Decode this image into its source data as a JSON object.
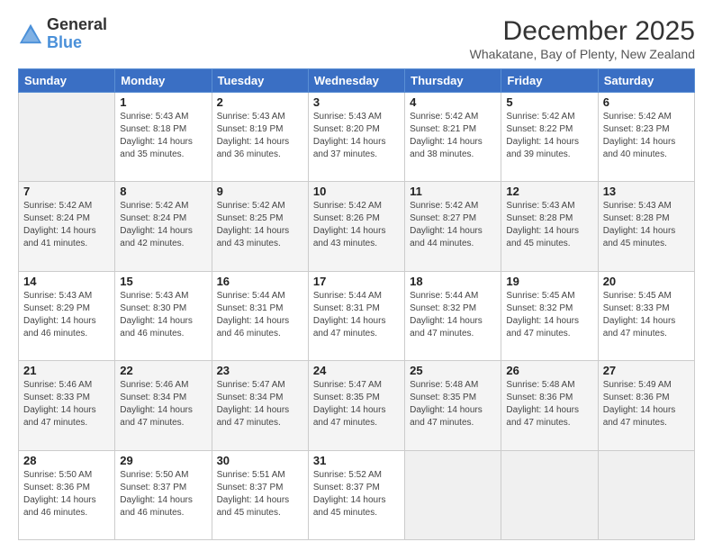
{
  "brand": {
    "name_general": "General",
    "name_blue": "Blue"
  },
  "header": {
    "month_year": "December 2025",
    "location": "Whakatane, Bay of Plenty, New Zealand"
  },
  "days_of_week": [
    "Sunday",
    "Monday",
    "Tuesday",
    "Wednesday",
    "Thursday",
    "Friday",
    "Saturday"
  ],
  "weeks": [
    [
      {
        "day": "",
        "sunrise": "",
        "sunset": "",
        "daylight": "",
        "empty": true
      },
      {
        "day": "1",
        "sunrise": "Sunrise: 5:43 AM",
        "sunset": "Sunset: 8:18 PM",
        "daylight": "Daylight: 14 hours and 35 minutes."
      },
      {
        "day": "2",
        "sunrise": "Sunrise: 5:43 AM",
        "sunset": "Sunset: 8:19 PM",
        "daylight": "Daylight: 14 hours and 36 minutes."
      },
      {
        "day": "3",
        "sunrise": "Sunrise: 5:43 AM",
        "sunset": "Sunset: 8:20 PM",
        "daylight": "Daylight: 14 hours and 37 minutes."
      },
      {
        "day": "4",
        "sunrise": "Sunrise: 5:42 AM",
        "sunset": "Sunset: 8:21 PM",
        "daylight": "Daylight: 14 hours and 38 minutes."
      },
      {
        "day": "5",
        "sunrise": "Sunrise: 5:42 AM",
        "sunset": "Sunset: 8:22 PM",
        "daylight": "Daylight: 14 hours and 39 minutes."
      },
      {
        "day": "6",
        "sunrise": "Sunrise: 5:42 AM",
        "sunset": "Sunset: 8:23 PM",
        "daylight": "Daylight: 14 hours and 40 minutes."
      }
    ],
    [
      {
        "day": "7",
        "sunrise": "Sunrise: 5:42 AM",
        "sunset": "Sunset: 8:24 PM",
        "daylight": "Daylight: 14 hours and 41 minutes."
      },
      {
        "day": "8",
        "sunrise": "Sunrise: 5:42 AM",
        "sunset": "Sunset: 8:24 PM",
        "daylight": "Daylight: 14 hours and 42 minutes."
      },
      {
        "day": "9",
        "sunrise": "Sunrise: 5:42 AM",
        "sunset": "Sunset: 8:25 PM",
        "daylight": "Daylight: 14 hours and 43 minutes."
      },
      {
        "day": "10",
        "sunrise": "Sunrise: 5:42 AM",
        "sunset": "Sunset: 8:26 PM",
        "daylight": "Daylight: 14 hours and 43 minutes."
      },
      {
        "day": "11",
        "sunrise": "Sunrise: 5:42 AM",
        "sunset": "Sunset: 8:27 PM",
        "daylight": "Daylight: 14 hours and 44 minutes."
      },
      {
        "day": "12",
        "sunrise": "Sunrise: 5:43 AM",
        "sunset": "Sunset: 8:28 PM",
        "daylight": "Daylight: 14 hours and 45 minutes."
      },
      {
        "day": "13",
        "sunrise": "Sunrise: 5:43 AM",
        "sunset": "Sunset: 8:28 PM",
        "daylight": "Daylight: 14 hours and 45 minutes."
      }
    ],
    [
      {
        "day": "14",
        "sunrise": "Sunrise: 5:43 AM",
        "sunset": "Sunset: 8:29 PM",
        "daylight": "Daylight: 14 hours and 46 minutes."
      },
      {
        "day": "15",
        "sunrise": "Sunrise: 5:43 AM",
        "sunset": "Sunset: 8:30 PM",
        "daylight": "Daylight: 14 hours and 46 minutes."
      },
      {
        "day": "16",
        "sunrise": "Sunrise: 5:44 AM",
        "sunset": "Sunset: 8:31 PM",
        "daylight": "Daylight: 14 hours and 46 minutes."
      },
      {
        "day": "17",
        "sunrise": "Sunrise: 5:44 AM",
        "sunset": "Sunset: 8:31 PM",
        "daylight": "Daylight: 14 hours and 47 minutes."
      },
      {
        "day": "18",
        "sunrise": "Sunrise: 5:44 AM",
        "sunset": "Sunset: 8:32 PM",
        "daylight": "Daylight: 14 hours and 47 minutes."
      },
      {
        "day": "19",
        "sunrise": "Sunrise: 5:45 AM",
        "sunset": "Sunset: 8:32 PM",
        "daylight": "Daylight: 14 hours and 47 minutes."
      },
      {
        "day": "20",
        "sunrise": "Sunrise: 5:45 AM",
        "sunset": "Sunset: 8:33 PM",
        "daylight": "Daylight: 14 hours and 47 minutes."
      }
    ],
    [
      {
        "day": "21",
        "sunrise": "Sunrise: 5:46 AM",
        "sunset": "Sunset: 8:33 PM",
        "daylight": "Daylight: 14 hours and 47 minutes."
      },
      {
        "day": "22",
        "sunrise": "Sunrise: 5:46 AM",
        "sunset": "Sunset: 8:34 PM",
        "daylight": "Daylight: 14 hours and 47 minutes."
      },
      {
        "day": "23",
        "sunrise": "Sunrise: 5:47 AM",
        "sunset": "Sunset: 8:34 PM",
        "daylight": "Daylight: 14 hours and 47 minutes."
      },
      {
        "day": "24",
        "sunrise": "Sunrise: 5:47 AM",
        "sunset": "Sunset: 8:35 PM",
        "daylight": "Daylight: 14 hours and 47 minutes."
      },
      {
        "day": "25",
        "sunrise": "Sunrise: 5:48 AM",
        "sunset": "Sunset: 8:35 PM",
        "daylight": "Daylight: 14 hours and 47 minutes."
      },
      {
        "day": "26",
        "sunrise": "Sunrise: 5:48 AM",
        "sunset": "Sunset: 8:36 PM",
        "daylight": "Daylight: 14 hours and 47 minutes."
      },
      {
        "day": "27",
        "sunrise": "Sunrise: 5:49 AM",
        "sunset": "Sunset: 8:36 PM",
        "daylight": "Daylight: 14 hours and 47 minutes."
      }
    ],
    [
      {
        "day": "28",
        "sunrise": "Sunrise: 5:50 AM",
        "sunset": "Sunset: 8:36 PM",
        "daylight": "Daylight: 14 hours and 46 minutes."
      },
      {
        "day": "29",
        "sunrise": "Sunrise: 5:50 AM",
        "sunset": "Sunset: 8:37 PM",
        "daylight": "Daylight: 14 hours and 46 minutes."
      },
      {
        "day": "30",
        "sunrise": "Sunrise: 5:51 AM",
        "sunset": "Sunset: 8:37 PM",
        "daylight": "Daylight: 14 hours and 45 minutes."
      },
      {
        "day": "31",
        "sunrise": "Sunrise: 5:52 AM",
        "sunset": "Sunset: 8:37 PM",
        "daylight": "Daylight: 14 hours and 45 minutes."
      },
      {
        "day": "",
        "sunrise": "",
        "sunset": "",
        "daylight": "",
        "empty": true
      },
      {
        "day": "",
        "sunrise": "",
        "sunset": "",
        "daylight": "",
        "empty": true
      },
      {
        "day": "",
        "sunrise": "",
        "sunset": "",
        "daylight": "",
        "empty": true
      }
    ]
  ]
}
